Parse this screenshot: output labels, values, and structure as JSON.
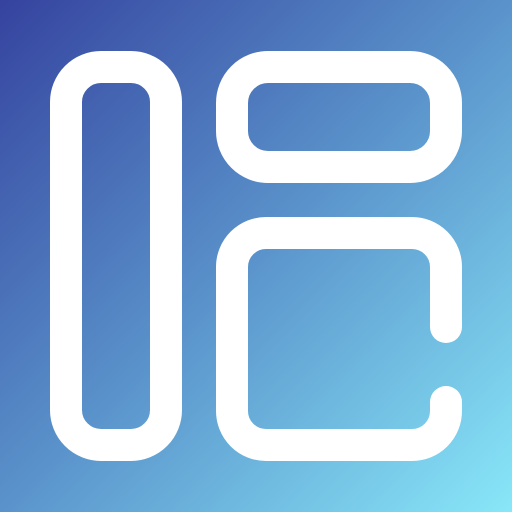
{
  "icon": {
    "name": "layout-dashboard-icon",
    "colors": {
      "gradient_start": "#35439f",
      "gradient_mid": "#5a93cb",
      "gradient_end": "#88e7f8",
      "stroke": "#ffffff"
    }
  }
}
